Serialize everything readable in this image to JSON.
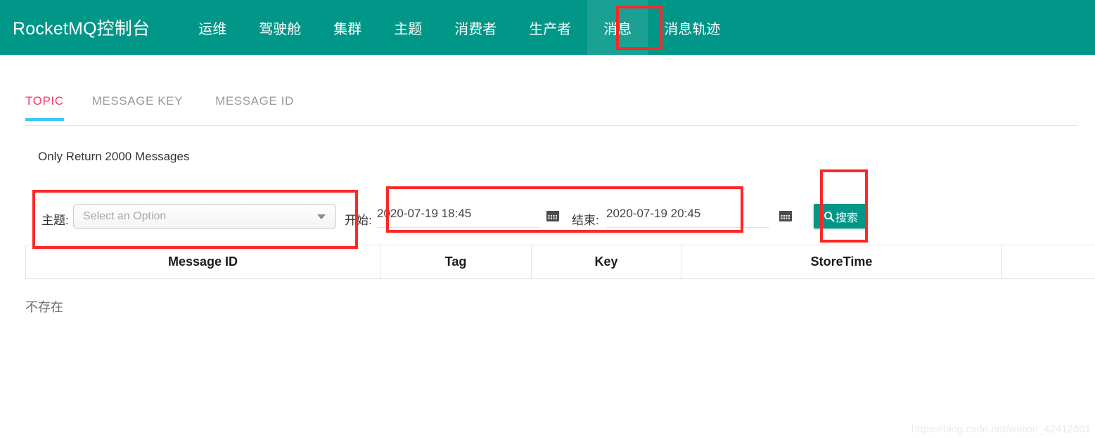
{
  "navbar": {
    "brand": "RocketMQ控制台",
    "items": [
      {
        "label": "运维",
        "active": false
      },
      {
        "label": "驾驶舱",
        "active": false
      },
      {
        "label": "集群",
        "active": false
      },
      {
        "label": "主题",
        "active": false
      },
      {
        "label": "消费者",
        "active": false
      },
      {
        "label": "生产者",
        "active": false
      },
      {
        "label": "消息",
        "active": true
      },
      {
        "label": "消息轨迹",
        "active": false
      }
    ],
    "background_color": "#009688",
    "active_background_color": "#1aa193"
  },
  "tabs": [
    {
      "label": "TOPIC",
      "active": true
    },
    {
      "label": "MESSAGE KEY",
      "active": false
    },
    {
      "label": "MESSAGE ID",
      "active": false
    }
  ],
  "tab_colors": {
    "active_text": "#f7396a",
    "active_underline": "#3ec6f5",
    "inactive_text": "#9a9a9a"
  },
  "notice": "Only Return 2000 Messages",
  "filter": {
    "topic_label": "主题:",
    "topic_select_value": "",
    "topic_select_placeholder": "Select an Option",
    "begin_label": "开始:",
    "begin_value": "2020-07-19 18:45",
    "end_label": "结束:",
    "end_value": "2020-07-19 20:45",
    "search_label": "搜索",
    "search_icon": "search-icon",
    "calendar_icon": "calendar-icon",
    "search_button_color": "#009688"
  },
  "table": {
    "headers": [
      "Message ID",
      "Tag",
      "Key",
      "StoreTime",
      ""
    ],
    "rows": [],
    "empty_message": "不存在"
  },
  "annotations": {
    "color": "#fc2828",
    "boxes": [
      "nav-message",
      "topic-field",
      "date-range",
      "search-button"
    ]
  },
  "watermark": "https://blog.csdn.net/weixin_42412601"
}
